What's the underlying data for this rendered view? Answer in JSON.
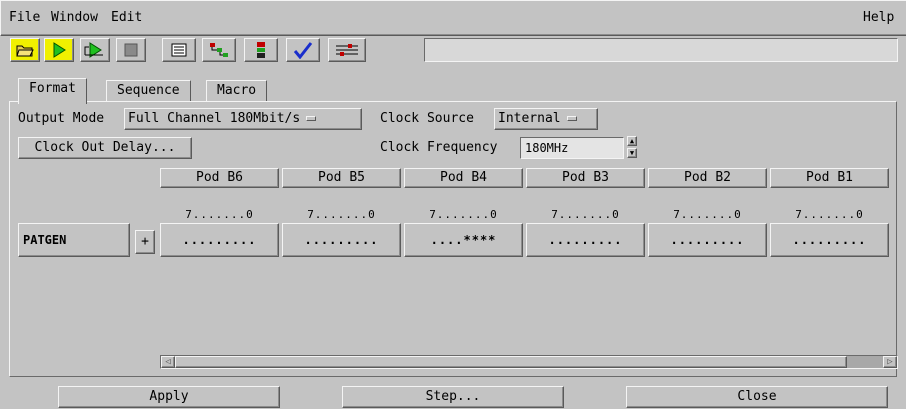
{
  "menu": {
    "file": "File",
    "window": "Window",
    "edit": "Edit",
    "help": "Help"
  },
  "toolbar": {
    "buttons": [
      "open-folder-icon",
      "run-icon",
      "run-repetitive-icon",
      "stop-icon",
      "list-icon",
      "navigator-icon",
      "status-icon",
      "checkmark-icon",
      "settings-icon"
    ],
    "field_value": ""
  },
  "tabs": {
    "format": "Format",
    "sequence": "Sequence",
    "macro": "Macro"
  },
  "output_mode": {
    "label": "Output Mode",
    "value": "Full Channel 180Mbit/s"
  },
  "clock_source": {
    "label": "Clock Source",
    "value": "Internal"
  },
  "clock_out_delay": "Clock Out Delay...",
  "clock_frequency": {
    "label": "Clock Frequency",
    "value": "180MHz"
  },
  "pods": [
    {
      "name": "Pod B6",
      "bits": "7.......0",
      "pattern": "........."
    },
    {
      "name": "Pod B5",
      "bits": "7.......0",
      "pattern": "........."
    },
    {
      "name": "Pod B4",
      "bits": "7.......0",
      "pattern": "....****"
    },
    {
      "name": "Pod B3",
      "bits": "7.......0",
      "pattern": "........."
    },
    {
      "name": "Pod B2",
      "bits": "7.......0",
      "pattern": "........."
    },
    {
      "name": "Pod B1",
      "bits": "7.......0",
      "pattern": "........."
    }
  ],
  "row": {
    "label": "PATGEN",
    "expand": "+"
  },
  "buttons": {
    "apply": "Apply",
    "step": "Step...",
    "close": "Close"
  },
  "colors": {
    "background": "#c3c3c3",
    "active_tool": "#f0f000",
    "check": "#1a2ecc"
  }
}
